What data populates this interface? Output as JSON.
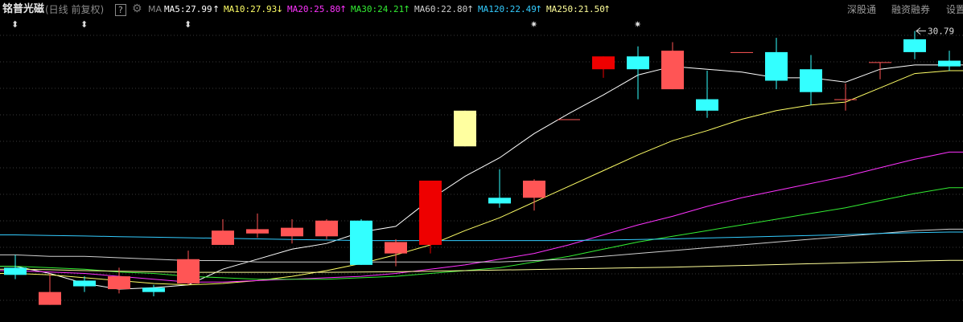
{
  "header": {
    "stock_name": "铭普光磁",
    "period": "(日线 前复权)",
    "help_label": "?",
    "indicator": "MA",
    "ma": [
      {
        "label": "MA5:27.99",
        "arrow": "↑",
        "color": "#ffffff"
      },
      {
        "label": "MA10:27.93",
        "arrow": "↓",
        "color": "#ffff66"
      },
      {
        "label": "MA20:25.80",
        "arrow": "↑",
        "color": "#ff33ff"
      },
      {
        "label": "MA30:24.21",
        "arrow": "↑",
        "color": "#33ee33"
      },
      {
        "label": "MA60:22.80",
        "arrow": "↑",
        "color": "#cfcfcf"
      },
      {
        "label": "MA120:22.49",
        "arrow": "↑",
        "color": "#33ccff"
      },
      {
        "label": "MA250:21.50",
        "arrow": "↑",
        "color": "#ffff99"
      }
    ],
    "links": [
      "深股通",
      "融资融券",
      "设置"
    ]
  },
  "markers": {
    "adjust_icon": "⬍",
    "star_icon": "✷"
  },
  "chart_data": {
    "type": "candlestick",
    "max_label": "30.79",
    "colors": {
      "up": "#ff5555",
      "up_strong": "#ee0000",
      "down": "#33ffff",
      "limit_up": "#ffffa0"
    },
    "candles": [
      {
        "o": 22.5,
        "c": 22.25,
        "h": 22.95,
        "l": 22.1
      },
      {
        "o": 21.2,
        "c": 21.65,
        "h": 22.3,
        "l": 21.2
      },
      {
        "o": 22.05,
        "c": 21.85,
        "h": 22.2,
        "l": 21.65
      },
      {
        "o": 21.75,
        "c": 22.2,
        "h": 22.5,
        "l": 21.6
      },
      {
        "o": 21.8,
        "c": 21.65,
        "h": 21.9,
        "l": 21.5
      },
      {
        "o": 21.95,
        "c": 22.8,
        "h": 23.1,
        "l": 21.9
      },
      {
        "o": 23.3,
        "c": 23.8,
        "h": 24.2,
        "l": 23.3
      },
      {
        "o": 23.7,
        "c": 23.85,
        "h": 24.4,
        "l": 23.55
      },
      {
        "o": 23.6,
        "c": 23.9,
        "h": 24.2,
        "l": 23.35
      },
      {
        "o": 23.6,
        "c": 24.15,
        "h": 24.2,
        "l": 23.5
      },
      {
        "o": 24.15,
        "c": 22.6,
        "h": 24.2,
        "l": 22.6
      },
      {
        "o": 23.0,
        "c": 23.4,
        "h": 23.5,
        "l": 22.55
      },
      {
        "o": 23.3,
        "c": 25.55,
        "h": 25.55,
        "l": 23.0
      },
      {
        "o": 26.75,
        "c": 28.0,
        "h": 28.0,
        "l": 26.75
      },
      {
        "o": 24.95,
        "c": 24.75,
        "h": 25.95,
        "l": 24.6
      },
      {
        "o": 24.95,
        "c": 25.55,
        "h": 25.6,
        "l": 24.5
      },
      {
        "o": 27.7,
        "c": 27.7,
        "h": 27.7,
        "l": 27.7
      },
      {
        "o": 29.45,
        "c": 29.9,
        "h": 29.9,
        "l": 29.15
      },
      {
        "o": 29.9,
        "c": 29.45,
        "h": 30.25,
        "l": 28.4
      },
      {
        "o": 28.75,
        "c": 30.1,
        "h": 30.4,
        "l": 28.75
      },
      {
        "o": 28.4,
        "c": 28.0,
        "h": 29.4,
        "l": 27.75
      },
      {
        "o": 30.05,
        "c": 30.05,
        "h": 30.05,
        "l": 30.05
      },
      {
        "o": 30.05,
        "c": 29.05,
        "h": 30.55,
        "l": 28.75
      },
      {
        "o": 29.45,
        "c": 28.65,
        "h": 29.95,
        "l": 28.2
      },
      {
        "o": 28.4,
        "c": 28.4,
        "h": 28.95,
        "l": 28.0
      },
      {
        "o": 29.7,
        "c": 29.7,
        "h": 29.7,
        "l": 29.1
      },
      {
        "o": 30.5,
        "c": 30.05,
        "h": 30.79,
        "l": 29.8
      },
      {
        "o": 29.75,
        "c": 29.55,
        "h": 30.1,
        "l": 29.4
      }
    ],
    "ma_series": [
      {
        "name": "MA5",
        "color": "#ffffff",
        "values": [
          22.55,
          22.3,
          21.95,
          21.75,
          21.8,
          21.9,
          22.45,
          22.8,
          23.15,
          23.35,
          23.75,
          23.95,
          24.9,
          25.7,
          26.35,
          27.2,
          27.9,
          28.55,
          29.25,
          29.55,
          29.45,
          29.35,
          29.15,
          29.15,
          29.0,
          29.45,
          29.6,
          29.6
        ]
      },
      {
        "name": "MA10",
        "color": "#ffff66",
        "values": [
          22.3,
          22.25,
          22.15,
          22.05,
          21.95,
          21.9,
          21.95,
          22.05,
          22.2,
          22.4,
          22.65,
          22.95,
          23.3,
          23.8,
          24.25,
          24.8,
          25.35,
          25.9,
          26.45,
          26.95,
          27.3,
          27.7,
          28.0,
          28.2,
          28.3,
          28.8,
          29.3,
          29.4
        ]
      },
      {
        "name": "MA20",
        "color": "#ff33ff",
        "values": [
          22.4,
          22.35,
          22.3,
          22.2,
          22.1,
          22.0,
          22.0,
          22.05,
          22.1,
          22.15,
          22.2,
          22.3,
          22.45,
          22.6,
          22.8,
          23.0,
          23.3,
          23.65,
          24.0,
          24.3,
          24.65,
          24.95,
          25.2,
          25.45,
          25.7,
          26.0,
          26.3,
          26.55
        ]
      },
      {
        "name": "MA30",
        "color": "#33ee33",
        "values": [
          22.55,
          22.5,
          22.45,
          22.35,
          22.3,
          22.2,
          22.15,
          22.1,
          22.1,
          22.1,
          22.15,
          22.2,
          22.3,
          22.4,
          22.5,
          22.7,
          22.9,
          23.15,
          23.4,
          23.6,
          23.8,
          24.0,
          24.2,
          24.4,
          24.6,
          24.85,
          25.1,
          25.3
        ]
      },
      {
        "name": "MA60",
        "color": "#cfcfcf",
        "values": [
          22.95,
          22.9,
          22.9,
          22.85,
          22.8,
          22.75,
          22.75,
          22.7,
          22.7,
          22.7,
          22.7,
          22.7,
          22.7,
          22.7,
          22.7,
          22.75,
          22.8,
          22.9,
          23.0,
          23.1,
          23.2,
          23.3,
          23.4,
          23.5,
          23.6,
          23.7,
          23.8,
          23.85
        ]
      },
      {
        "name": "MA120",
        "color": "#33ccff",
        "values": [
          23.65,
          23.63,
          23.61,
          23.59,
          23.57,
          23.55,
          23.53,
          23.51,
          23.49,
          23.47,
          23.45,
          23.45,
          23.45,
          23.45,
          23.45,
          23.45,
          23.45,
          23.47,
          23.49,
          23.51,
          23.54,
          23.57,
          23.6,
          23.63,
          23.66,
          23.7,
          23.73,
          23.75
        ]
      },
      {
        "name": "MA250",
        "color": "#ffff99",
        "values": [
          22.45,
          22.43,
          22.4,
          22.38,
          22.36,
          22.34,
          22.34,
          22.34,
          22.34,
          22.34,
          22.35,
          22.36,
          22.38,
          22.4,
          22.42,
          22.44,
          22.46,
          22.48,
          22.5,
          22.52,
          22.55,
          22.58,
          22.61,
          22.64,
          22.67,
          22.7,
          22.73,
          22.76
        ]
      }
    ],
    "markers": [
      {
        "index": 0,
        "kind": "adjust"
      },
      {
        "index": 2,
        "kind": "adjust"
      },
      {
        "index": 5,
        "kind": "adjust"
      },
      {
        "index": 15,
        "kind": "star"
      },
      {
        "index": 18,
        "kind": "star"
      }
    ],
    "ylim": [
      20.6,
      31.2
    ],
    "grid": true
  }
}
